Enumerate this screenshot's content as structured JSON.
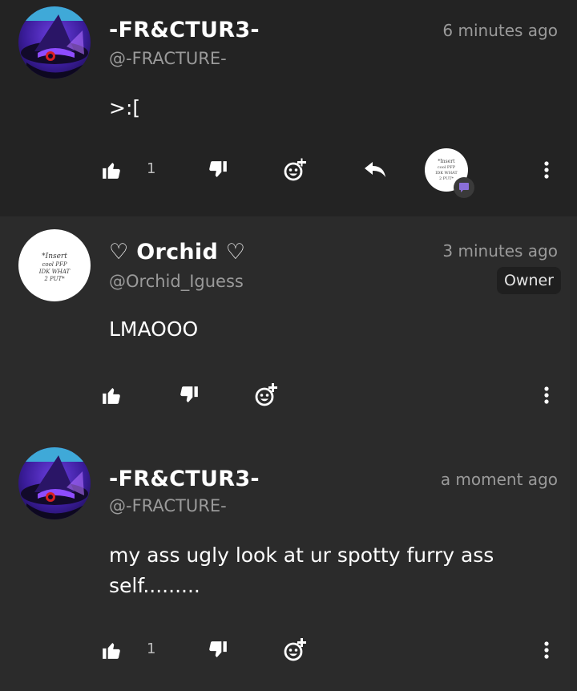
{
  "comments": [
    {
      "display_name": "-FR&CTUR3-",
      "handle": "@-FRACTURE-",
      "timestamp": "6 minutes ago",
      "body": ">:[",
      "like_count": "1",
      "avatar": "purple-witch-hat-avatar"
    },
    {
      "display_name": "♡ Orchid ♡",
      "handle": "@Orchid_Iguess",
      "timestamp": "3 minutes ago",
      "badge": "Owner",
      "body": "LMAOOO",
      "avatar": "handwritten-text-avatar",
      "avatar_text": "*Insert cool PFP IDK WHAT 2 PUT*"
    },
    {
      "display_name": "-FR&CTUR3-",
      "handle": "@-FRACTURE-",
      "timestamp": "a moment ago",
      "body": "my ass ugly look at ur spotty furry ass self.........",
      "like_count": "1",
      "avatar": "purple-witch-hat-avatar"
    }
  ],
  "icons": {
    "like": "thumbs-up-icon",
    "dislike": "thumbs-down-icon",
    "react": "add-reaction-icon",
    "reply": "reply-arrow-icon",
    "more": "more-vertical-icon",
    "reply_indicator": "chat-bubble-icon"
  },
  "colors": {
    "first_comment_bg": "#232323",
    "comment_bg": "#2b2b2b",
    "secondary_text": "#9a9a9a",
    "reply_badge": "#8a6fd8"
  }
}
